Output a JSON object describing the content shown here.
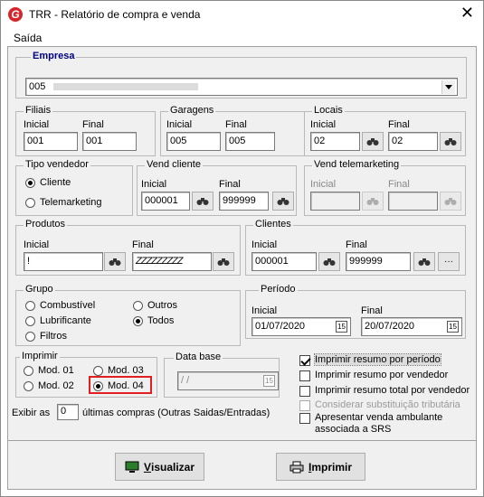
{
  "window": {
    "title": "TRR - Relatório de compra e venda",
    "close_glyph": "✕"
  },
  "menu": {
    "saida": "Saída"
  },
  "empresa": {
    "label": "Empresa",
    "value": "005"
  },
  "filiais": {
    "label": "Filiais",
    "inicial_label": "Inicial",
    "final_label": "Final",
    "inicial": "001",
    "final": "001"
  },
  "garagens": {
    "label": "Garagens",
    "inicial_label": "Inicial",
    "final_label": "Final",
    "inicial": "005",
    "final": "005"
  },
  "locais": {
    "label": "Locais",
    "inicial_label": "Inicial",
    "final_label": "Final",
    "inicial": "02",
    "final": "02"
  },
  "tipo_vendedor": {
    "label": "Tipo vendedor",
    "options": [
      "Cliente",
      "Telemarketing"
    ],
    "selected": "Cliente"
  },
  "vend_cliente": {
    "label": "Vend cliente",
    "inicial_label": "Inicial",
    "final_label": "Final",
    "inicial": "000001",
    "final": "999999"
  },
  "vend_telemarketing": {
    "label": "Vend telemarketing",
    "inicial_label": "Inicial",
    "final_label": "Final",
    "inicial": "",
    "final": ""
  },
  "produtos": {
    "label": "Produtos",
    "inicial_label": "Inicial",
    "final_label": "Final",
    "inicial": "!",
    "final": "ZZZZZZZZZ"
  },
  "clientes": {
    "label": "Clientes",
    "inicial_label": "Inicial",
    "final_label": "Final",
    "inicial": "000001",
    "final": "999999",
    "more_label": "···"
  },
  "grupo": {
    "label": "Grupo",
    "options": [
      "Combustível",
      "Lubrificante",
      "Filtros",
      "Outros",
      "Todos"
    ],
    "selected": "Todos"
  },
  "periodo": {
    "label": "Período",
    "inicial_label": "Inicial",
    "final_label": "Final",
    "inicial": "01/07/2020",
    "final": "20/07/2020",
    "cal_label": "15"
  },
  "imprimir": {
    "label": "Imprimir",
    "options": [
      "Mod. 01",
      "Mod. 02",
      "Mod. 03",
      "Mod. 04"
    ],
    "selected": "Mod. 04"
  },
  "data_base": {
    "label": "Data base",
    "value": " / /",
    "cal_label": "15"
  },
  "checks": [
    {
      "label": "Imprimir resumo por período",
      "checked": true,
      "enabled": true
    },
    {
      "label": "Imprimir resumo por vendedor",
      "checked": false,
      "enabled": true
    },
    {
      "label": "Imprimir resumo total por vendedor",
      "checked": false,
      "enabled": true
    },
    {
      "label": "Considerar substituição tributária",
      "checked": false,
      "enabled": false
    },
    {
      "label": "Apresentar venda ambulante",
      "label2": "associada a SRS",
      "checked": false,
      "enabled": true
    }
  ],
  "exibir": {
    "prefix": "Exibir as",
    "value": "0",
    "suffix": "últimas compras (Outras Saidas/Entradas)"
  },
  "buttons": {
    "visualizar_first": "V",
    "visualizar_rest": "isualizar",
    "imprimir_first": "I",
    "imprimir_rest": "mprimir"
  },
  "colors": {
    "accent_label": "#000080",
    "highlight": "#e02020"
  }
}
